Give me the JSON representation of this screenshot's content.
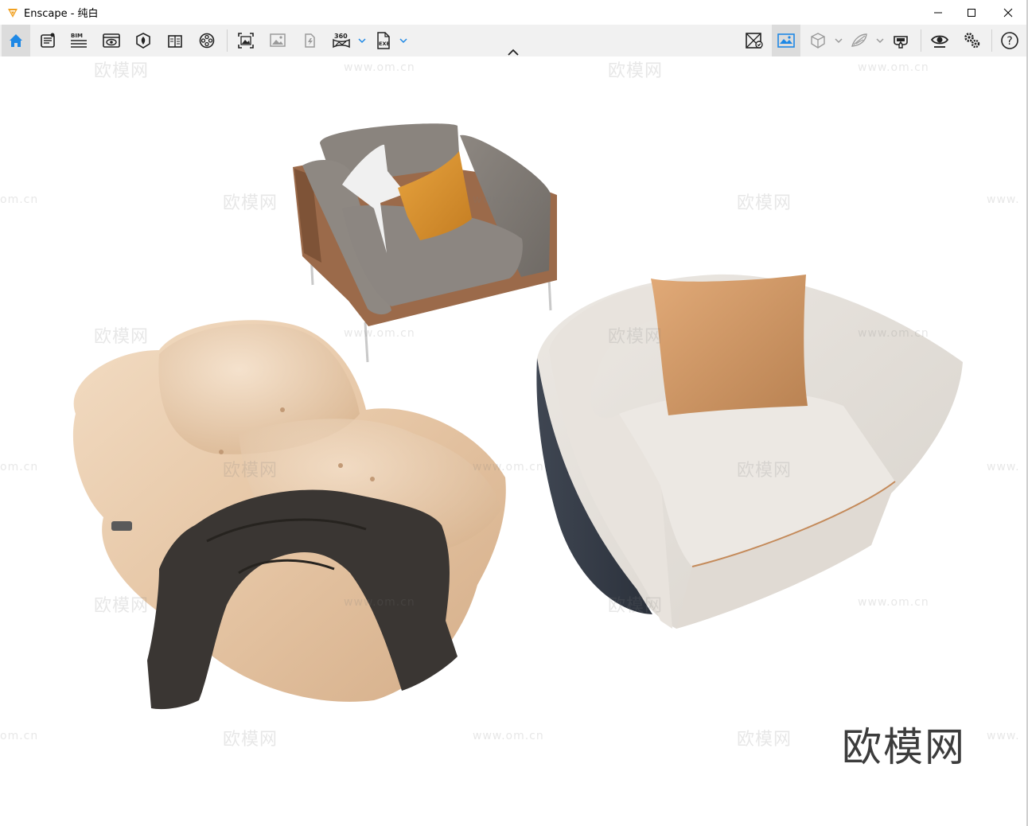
{
  "window": {
    "title": "Enscape - 纯白",
    "accent": "#f0a020"
  },
  "toolbar": {
    "left_icons": [
      "home-icon",
      "document-list-icon",
      "bim-icon",
      "visual-settings-icon",
      "asset-library-icon",
      "material-editor-icon",
      "video-editor-icon",
      "screenshot-icon",
      "image-gallery-icon",
      "light-view-icon",
      "panorama-360-icon",
      "exe-export-icon"
    ],
    "bim_label": "BIM",
    "pano_label": "360",
    "exe_label": "EXE",
    "right_icons": [
      "sync-views-icon",
      "safe-frame-icon",
      "orthographic-cube-icon",
      "sun-wing-icon",
      "vr-headset-icon",
      "eye-icon",
      "settings-gears-icon",
      "help-icon"
    ],
    "help_label": "?"
  },
  "viewport": {
    "watermark_text": "欧模网",
    "watermark_url": "www.om.cn",
    "watermark_partial": "om.cn",
    "watermark_partial_left": "www.",
    "brand_text": "欧模网"
  }
}
